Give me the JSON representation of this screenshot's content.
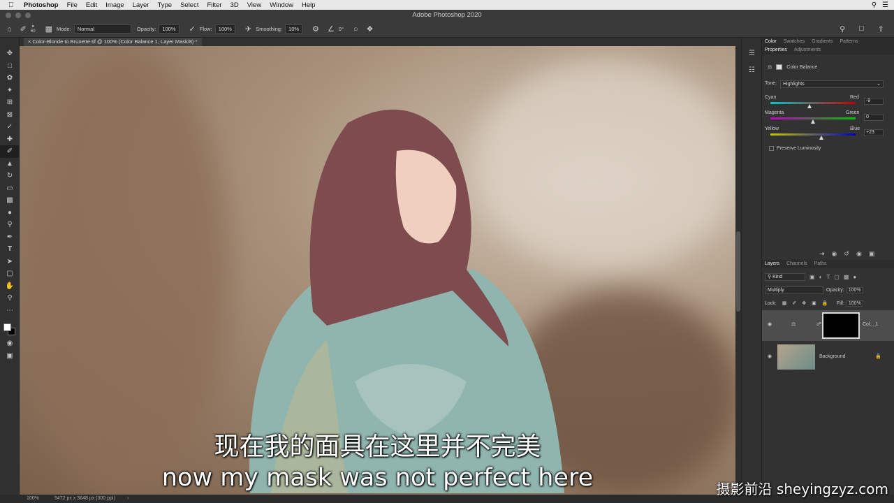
{
  "menubar": {
    "app": "Photoshop",
    "items": [
      "File",
      "Edit",
      "Image",
      "Layer",
      "Type",
      "Select",
      "Filter",
      "3D",
      "View",
      "Window",
      "Help"
    ]
  },
  "window": {
    "title": "Adobe Photoshop 2020"
  },
  "options": {
    "brush_size": "60",
    "mode_label": "Mode:",
    "mode_value": "Normal",
    "opacity_label": "Opacity:",
    "opacity_value": "100%",
    "flow_label": "Flow:",
    "flow_value": "100%",
    "smoothing_label": "Smoothing:",
    "smoothing_value": "10%",
    "angle_value": "0°"
  },
  "document": {
    "tab_title": "Color-Blonde to Brunette.tif @ 100% (Color Balance 1, Layer Mask/8) *"
  },
  "panels": {
    "top_tabs": [
      "Color",
      "Swatches",
      "Gradients",
      "Patterns"
    ],
    "prop_tabs": [
      "Properties",
      "Adjustments"
    ],
    "properties": {
      "title": "Color Balance",
      "tone_label": "Tone:",
      "tone_value": "Highlights",
      "sliders": [
        {
          "left": "Cyan",
          "right": "Red",
          "value": "-9",
          "fraction": 0.46
        },
        {
          "left": "Magenta",
          "right": "Green",
          "value": "0",
          "fraction": 0.5
        },
        {
          "left": "Yellow",
          "right": "Blue",
          "value": "+23",
          "fraction": 0.6
        }
      ],
      "preserve_label": "Preserve Luminosity"
    },
    "layers_tabs": [
      "Layers",
      "Channels",
      "Paths"
    ],
    "layers": {
      "kind_label": "Kind",
      "blend_mode": "Multiply",
      "opacity_label": "Opacity:",
      "opacity_value": "100%",
      "lock_label": "Lock:",
      "fill_label": "Fill:",
      "fill_value": "100%",
      "items": [
        {
          "name": "Col... 1"
        },
        {
          "name": "Background"
        }
      ]
    }
  },
  "status": {
    "zoom": "100%",
    "doc_info": "5472 px x 3648 px (300 ppi)"
  },
  "subtitles": {
    "chinese": "现在我的面具在这里并不完美",
    "english": "now my mask was not perfect here"
  },
  "watermark": "摄影前沿 sheyingzyz.com"
}
